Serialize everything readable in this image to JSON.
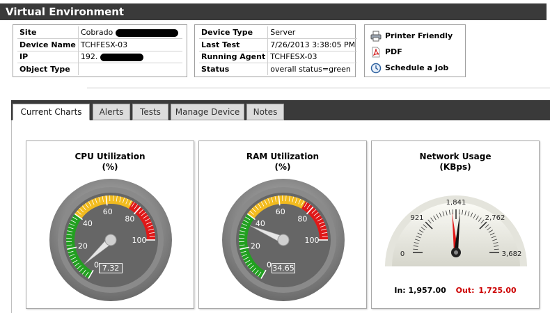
{
  "header": {
    "title": "Virtual Environment"
  },
  "device_info_left": [
    {
      "label": "Site",
      "value": "Cobrado"
    },
    {
      "label": "Device Name",
      "value": "TCHFESX-03"
    },
    {
      "label": "IP",
      "value": "192."
    },
    {
      "label": "Object Type",
      "value": ""
    }
  ],
  "device_info_right": [
    {
      "label": "Device Type",
      "value": "Server"
    },
    {
      "label": "Last Test",
      "value": "7/26/2013 3:38:05 PM"
    },
    {
      "label": "Running Agent",
      "value": "TCHFESX-03"
    },
    {
      "label": "Status",
      "value": "overall status=green"
    }
  ],
  "actions": [
    {
      "label": "Printer Friendly",
      "icon": "printer-icon"
    },
    {
      "label": "PDF",
      "icon": "pdf-icon"
    },
    {
      "label": "Schedule a Job",
      "icon": "clock-icon"
    }
  ],
  "tabs": [
    {
      "label": "Current Charts",
      "active": true
    },
    {
      "label": "Alerts",
      "active": false
    },
    {
      "label": "Tests",
      "active": false
    },
    {
      "label": "Manage Device",
      "active": false
    },
    {
      "label": "Notes",
      "active": false
    }
  ],
  "gauges": {
    "cpu": {
      "title": "CPU Utilization",
      "unit": "(%)",
      "value": 7.32,
      "display": "7.32",
      "ticks": [
        "0",
        "20",
        "40",
        "60",
        "80",
        "100"
      ]
    },
    "ram": {
      "title": "RAM Utilization",
      "unit": "(%)",
      "value": 34.65,
      "display": "34.65",
      "ticks": [
        "0",
        "20",
        "40",
        "60",
        "80",
        "100"
      ]
    },
    "network": {
      "title": "Network Usage",
      "unit": "(KBps)",
      "ticks": [
        "0",
        "921",
        "1,841",
        "2,762",
        "3,682"
      ],
      "max": 3682,
      "in_value": 1957,
      "out_value": 1725,
      "in_label": "In:",
      "in_display": "1,957.00",
      "out_label": "Out:",
      "out_display": "1,725.00"
    }
  },
  "colors": {
    "green": "#22a020",
    "yellow": "#f2bb1f",
    "red": "#e01818",
    "header_bg": "#3a3a3a",
    "out_red": "#cc0000"
  }
}
